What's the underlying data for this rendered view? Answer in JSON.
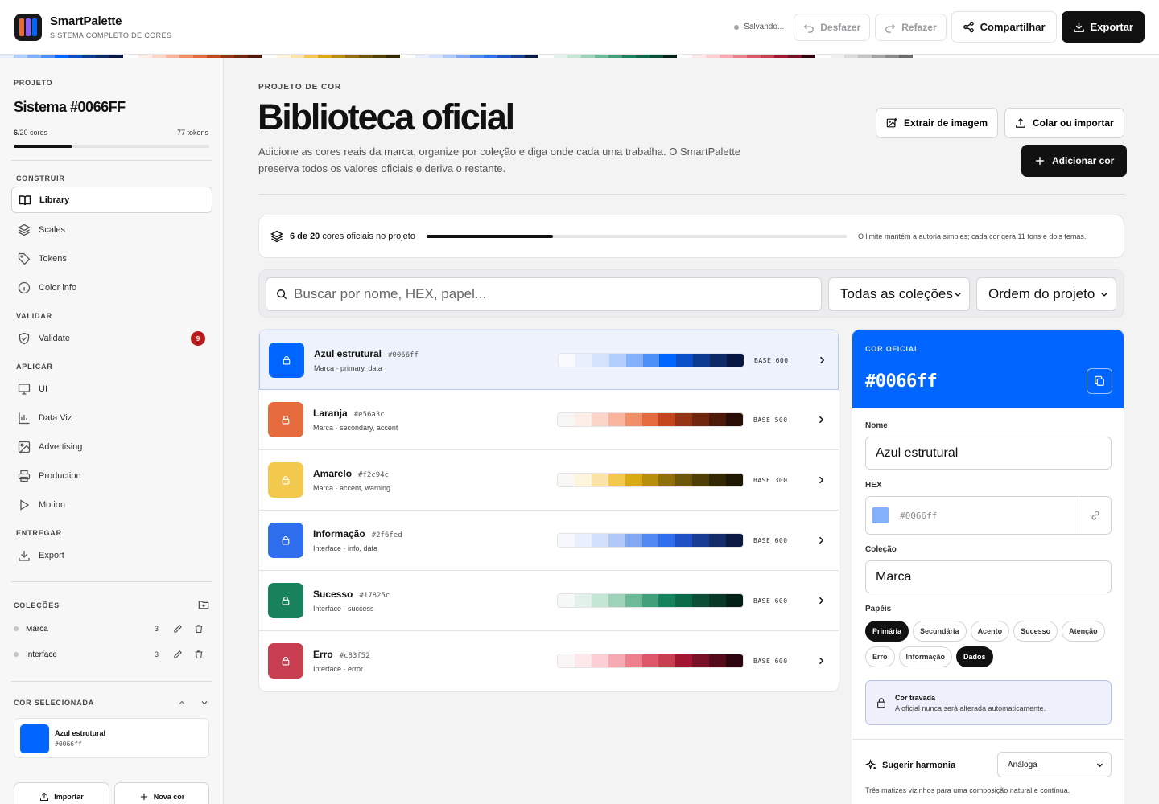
{
  "app": {
    "name": "SmartPalette",
    "subtitle": "SISTEMA COMPLETO DE CORES",
    "saving_status": "Salvando...",
    "undo": "Desfazer",
    "redo": "Refazer",
    "share": "Compartilhar",
    "export": "Exportar"
  },
  "sidebar": {
    "project_label": "PROJETO",
    "project_title": "Sistema #0066FF",
    "colors_count": "6",
    "colors_total": "/20 cores",
    "tokens": "77 tokens",
    "colors_progress": 0.3,
    "sections": {
      "build": "CONSTRUIR",
      "validate": "VALIDAR",
      "apply": "APLICAR",
      "deliver": "ENTREGAR"
    },
    "nav": {
      "library": "Library",
      "scales": "Scales",
      "tokens": "Tokens",
      "color_info": "Color info",
      "validate": "Validate",
      "validate_badge": "9",
      "ui": "UI",
      "data_viz": "Data Viz",
      "advertising": "Advertising",
      "production": "Production",
      "motion": "Motion",
      "export": "Export"
    },
    "collections_label": "COLEÇÕES",
    "collections": [
      {
        "name": "Marca",
        "count": "3"
      },
      {
        "name": "Interface",
        "count": "3"
      }
    ],
    "selected_label": "COR SELECIONADA",
    "selected_name": "Azul estrutural",
    "selected_hex": "#0066ff",
    "selected_color": "#0066ff",
    "import": "Importar",
    "new_color": "Nova cor"
  },
  "main": {
    "eyebrow": "PROJETO DE COR",
    "title": "Biblioteca oficial",
    "description": "Adicione as cores reais da marca, organize por coleção e diga onde cada uma trabalha. O SmartPalette preserva todos os valores oficiais e deriva o restante.",
    "extract_image": "Extrair de imagem",
    "paste_import": "Colar ou importar",
    "add_color": "Adicionar cor",
    "limit_count": "6 de 20",
    "limit_text": "cores oficiais no projeto",
    "limit_progress": 0.3,
    "limit_note": "O limite mantém a autoria simples; cada cor gera 11 tons e dois temas.",
    "search_placeholder": "Buscar por nome, HEX, papel...",
    "collection_filter": "Todas as coleções",
    "order_filter": "Ordem do projeto"
  },
  "colors": [
    {
      "name": "Azul estrutural",
      "hex": "#0066ff",
      "sub": "Marca · primary, data",
      "base": "BASE 600",
      "color": "#0066ff",
      "ramp": [
        "#f7f9fd",
        "#e8f0fe",
        "#d4e2fd",
        "#b2cefc",
        "#82b0fb",
        "#4d8ff9",
        "#0066ff",
        "#0a4fc7",
        "#0d3a91",
        "#0c2a66",
        "#061741"
      ]
    },
    {
      "name": "Laranja",
      "hex": "#e56a3c",
      "sub": "Marca · secondary, accent",
      "base": "BASE 500",
      "color": "#e56a3c",
      "ramp": [
        "#f9f7f6",
        "#fdeee8",
        "#fbd6c8",
        "#f8b49c",
        "#f28e67",
        "#e56a3c",
        "#c4461d",
        "#963314",
        "#70260f",
        "#4d1a0a",
        "#2a0e05"
      ]
    },
    {
      "name": "Amarelo",
      "hex": "#f2c94c",
      "sub": "Marca · accent, warning",
      "base": "BASE 300",
      "color": "#f2c94c",
      "ramp": [
        "#f9f8f5",
        "#fdf5de",
        "#f9e3a6",
        "#f2c94c",
        "#d9aa12",
        "#b68f0c",
        "#8f700a",
        "#6e5608",
        "#4f3e06",
        "#332804",
        "#1f1802"
      ]
    },
    {
      "name": "Informação",
      "hex": "#2f6fed",
      "sub": "Interface · info, data",
      "base": "BASE 600",
      "color": "#2f6fed",
      "ramp": [
        "#f7f8fd",
        "#e9effd",
        "#d3e0fb",
        "#b1c9f8",
        "#82a8f3",
        "#5189f0",
        "#2f6fed",
        "#1f50c6",
        "#183c93",
        "#132c6a",
        "#0b1a42"
      ]
    },
    {
      "name": "Sucesso",
      "hex": "#17825c",
      "sub": "Interface · success",
      "base": "BASE 600",
      "color": "#17825c",
      "ramp": [
        "#f5f8f6",
        "#e2f2ea",
        "#c4e6d4",
        "#9fd3b9",
        "#6db998",
        "#41a07a",
        "#17825c",
        "#0d6a49",
        "#0b4f37",
        "#083826",
        "#042117"
      ]
    },
    {
      "name": "Erro",
      "hex": "#c83f52",
      "sub": "Interface · error",
      "base": "BASE 600",
      "color": "#c83f52",
      "ramp": [
        "#faf6f6",
        "#fde8ea",
        "#fbcfd4",
        "#f6aab3",
        "#ee7f8d",
        "#dd5669",
        "#c83f52",
        "#a21533",
        "#7a1027",
        "#560b1b",
        "#2e050e"
      ]
    }
  ],
  "detail": {
    "eyebrow": "COR OFICIAL",
    "hex": "#0066ff",
    "color": "#0066ff",
    "name_label": "Nome",
    "name_value": "Azul estrutural",
    "hex_label": "HEX",
    "hex_value": "#0066ff",
    "swatch_color": "#82b0fb",
    "collection_label": "Coleção",
    "collection_value": "Marca",
    "roles_label": "Papéis",
    "roles": [
      {
        "label": "Primária",
        "active": true
      },
      {
        "label": "Secundária",
        "active": false
      },
      {
        "label": "Acento",
        "active": false
      },
      {
        "label": "Sucesso",
        "active": false
      },
      {
        "label": "Atenção",
        "active": false
      },
      {
        "label": "Erro",
        "active": false
      },
      {
        "label": "Informação",
        "active": false
      },
      {
        "label": "Dados",
        "active": true
      }
    ],
    "locked_title": "Cor travada",
    "locked_text": "A oficial nunca será alterada automaticamente.",
    "harmony_label": "Sugerir harmonia",
    "harmony_value": "Análoga",
    "harmony_desc": "Três matizes vizinhos para uma composição natural e contínua."
  },
  "stripe_groups": [
    [
      "#e8f0fe",
      "#b2cefc",
      "#82b0fb",
      "#4d8ff9",
      "#0066ff",
      "#0a4fc7",
      "#0d3a91",
      "#0c2a66",
      "#061741"
    ],
    [
      "#fdeee8",
      "#fbd6c8",
      "#f8b49c",
      "#f28e67",
      "#e56a3c",
      "#c4461d",
      "#963314",
      "#70260f",
      "#4d1a0a"
    ],
    [
      "#fdf5de",
      "#f9e3a6",
      "#f2c94c",
      "#d9aa12",
      "#b68f0c",
      "#8f700a",
      "#6e5608",
      "#4f3e06",
      "#332804"
    ],
    [
      "#e9effd",
      "#d3e0fb",
      "#b1c9f8",
      "#82a8f3",
      "#5189f0",
      "#2f6fed",
      "#1f50c6",
      "#183c93",
      "#0b1a42"
    ],
    [
      "#e2f2ea",
      "#c4e6d4",
      "#9fd3b9",
      "#6db998",
      "#41a07a",
      "#17825c",
      "#0d6a49",
      "#0b4f37",
      "#042117"
    ],
    [
      "#fde8ea",
      "#fbcfd4",
      "#f6aab3",
      "#ee7f8d",
      "#dd5669",
      "#c83f52",
      "#a21533",
      "#7a1027",
      "#2e050e"
    ],
    [
      "#eeeeee",
      "#d9d9d9",
      "#c4c4c4",
      "#a3a3a3",
      "#8a8a8a",
      "#6b6b6b"
    ]
  ]
}
